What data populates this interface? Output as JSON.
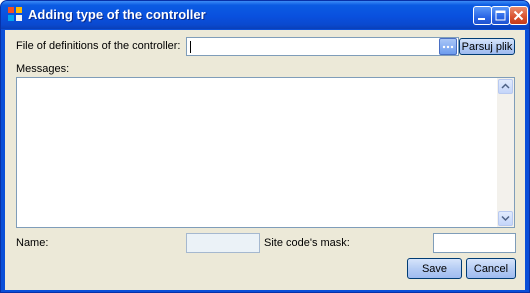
{
  "window": {
    "title": "Adding type of the controller",
    "controls": [
      "minimize-icon",
      "maximize-icon",
      "close-icon"
    ]
  },
  "form": {
    "definitions_label": "File of definitions of the controller:",
    "definitions_value": "",
    "browse_button_label": "...",
    "parse_button_label": "Parsuj plik",
    "messages_label": "Messages:",
    "messages_value": "",
    "name_label": "Name:",
    "name_value": "",
    "mask_label": "Site code's mask:",
    "mask_value": ""
  },
  "buttons": {
    "save_label": "Save",
    "cancel_label": "Cancel"
  },
  "colors": {
    "titlebar": "#0a5be3",
    "client_bg": "#ece9d8",
    "field_border": "#7f9db9",
    "disabled_field": "#ebf2f7"
  }
}
